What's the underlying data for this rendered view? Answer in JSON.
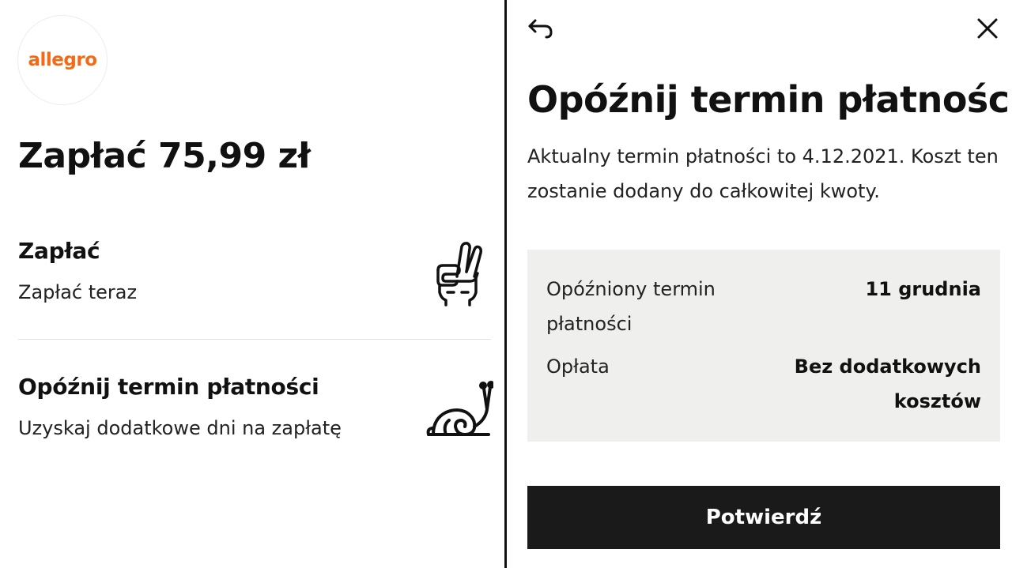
{
  "left": {
    "logo_text": "allegro",
    "title": "Zapłać 75,99 zł",
    "options": [
      {
        "title": "Zapłać",
        "subtitle": "Zapłać teraz",
        "icon": "peace-hand-icon"
      },
      {
        "title": "Opóźnij termin płatności",
        "subtitle": "Uzyskaj dodatkowe dni na zapłatę",
        "icon": "snail-icon"
      }
    ]
  },
  "right": {
    "back_icon": "back-arrow-icon",
    "close_icon": "close-icon",
    "title": "Opóźnij termin płatności",
    "description": "Aktualny termin płatności to 4.12.2021. Koszt ten zostanie dodany do całkowitej kwoty.",
    "details": [
      {
        "label": "Opóźniony termin płatności",
        "value": "11 grudnia"
      },
      {
        "label": "Opłata",
        "value": "Bez dodatkowych kosztów"
      }
    ],
    "confirm_label": "Potwierdź"
  },
  "colors": {
    "brand": "#f36a16",
    "button_bg": "#1a1a1a",
    "box_bg": "#efefee"
  }
}
